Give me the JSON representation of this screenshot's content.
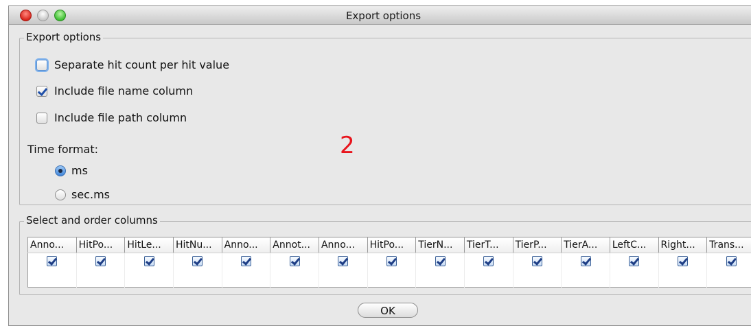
{
  "window": {
    "title": "Export options"
  },
  "export_group": {
    "label": "Export options",
    "options": [
      {
        "label": "Separate hit count per hit value",
        "checked": false,
        "focused": true
      },
      {
        "label": "Include file name column",
        "checked": true,
        "focused": false
      },
      {
        "label": "Include file path column",
        "checked": false,
        "focused": false
      }
    ],
    "time_format_label": "Time format:",
    "time_formats": [
      {
        "label": "ms",
        "selected": true
      },
      {
        "label": "sec.ms",
        "selected": false
      }
    ]
  },
  "annotation": "2",
  "columns_group": {
    "label": "Select and order columns",
    "columns": [
      {
        "header": "Anno...",
        "checked": true
      },
      {
        "header": "HitPo...",
        "checked": true
      },
      {
        "header": "HitLe...",
        "checked": true
      },
      {
        "header": "HitNu...",
        "checked": true
      },
      {
        "header": "Anno...",
        "checked": true
      },
      {
        "header": "Annot...",
        "checked": true
      },
      {
        "header": "Anno...",
        "checked": true
      },
      {
        "header": "HitPo...",
        "checked": true
      },
      {
        "header": "TierN...",
        "checked": true
      },
      {
        "header": "TierT...",
        "checked": true
      },
      {
        "header": "TierP...",
        "checked": true
      },
      {
        "header": "TierA...",
        "checked": true
      },
      {
        "header": "LeftC...",
        "checked": true
      },
      {
        "header": "Right...",
        "checked": true
      },
      {
        "header": "Trans...",
        "checked": true
      }
    ]
  },
  "ok_button": {
    "label": "OK"
  },
  "colors": {
    "accent": "#3f84d8",
    "annotation": "#e8141c"
  }
}
